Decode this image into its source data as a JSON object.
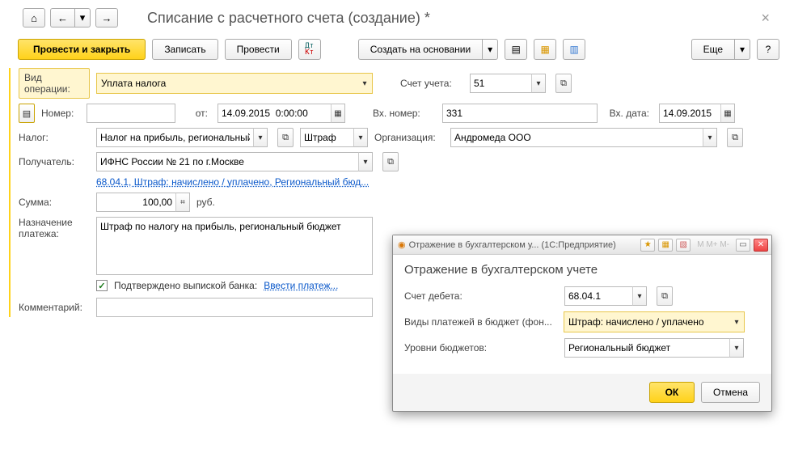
{
  "page": {
    "title": "Списание с расчетного счета (создание) *"
  },
  "toolbar": {
    "primary": "Провести и закрыть",
    "save": "Записать",
    "post": "Провести",
    "create_based": "Создать на основании",
    "more": "Еще",
    "help": "?"
  },
  "labels": {
    "op_type": "Вид операции:",
    "account": "Счет учета:",
    "number": "Номер:",
    "from": "от:",
    "inc_number": "Вх. номер:",
    "inc_date": "Вх. дата:",
    "tax": "Налог:",
    "org": "Организация:",
    "recipient": "Получатель:",
    "sum": "Сумма:",
    "rub": "руб.",
    "purpose": "Назначение платежа:",
    "confirmed": "Подтверждено выпиской банка:",
    "enter_pay": "Ввести платеж...",
    "comment": "Комментарий:"
  },
  "values": {
    "op_type": "Уплата налога",
    "account": "51",
    "number": "",
    "date": "14.09.2015  0:00:00",
    "inc_number": "331",
    "inc_date": "14.09.2015",
    "tax": "Налог на прибыль, региональный",
    "tax_kind": "Штраф",
    "org": "Андромеда ООО",
    "recipient": "ИФНС России № 21 по г.Москве",
    "recipient_link": "68.04.1, Штраф: начислено / уплачено, Региональный бюд...",
    "sum": "100,00",
    "purpose": "Штраф по налогу на прибыль, региональный бюджет",
    "confirmed": true,
    "comment": ""
  },
  "modal": {
    "titlebar": "Отражение в бухгалтерском у...   (1С:Предприятие)",
    "heading": "Отражение в бухгалтерском учете",
    "labels": {
      "debit": "Счет дебета:",
      "pay_kind": "Виды платежей в бюджет (фон...",
      "budget_level": "Уровни бюджетов:"
    },
    "values": {
      "debit": "68.04.1",
      "pay_kind": "Штраф: начислено / уплачено",
      "budget_level": "Региональный бюджет"
    },
    "ok": "ОК",
    "cancel": "Отмена"
  }
}
